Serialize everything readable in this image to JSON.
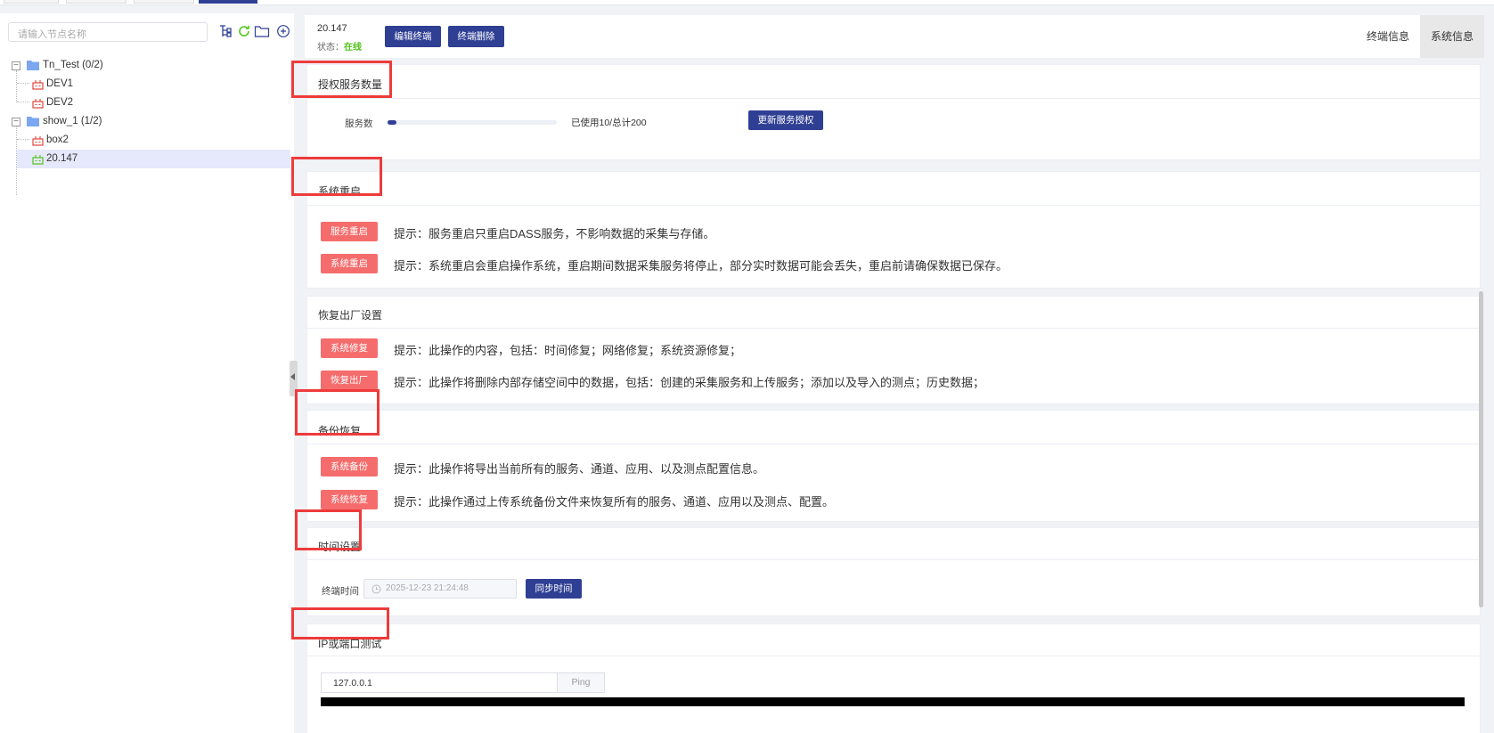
{
  "left": {
    "search_placeholder": "请输入节点名称",
    "tree": [
      {
        "label": "Tn_Test (0/2)",
        "type": "group",
        "expander": "−"
      },
      {
        "label": "DEV1",
        "type": "device",
        "status": "offline"
      },
      {
        "label": "DEV2",
        "type": "device",
        "status": "offline"
      },
      {
        "label": "show_1 (1/2)",
        "type": "group",
        "expander": "−"
      },
      {
        "label": "box2",
        "type": "device",
        "status": "offline"
      },
      {
        "label": "20.147",
        "type": "device",
        "status": "online",
        "selected": true
      }
    ]
  },
  "header": {
    "ip": "20.147",
    "status_label": "状态：",
    "status_value": "在线",
    "edit_button": "编辑终端",
    "delete_button": "终端删除",
    "tabs": [
      "终端信息",
      "系统信息"
    ],
    "active_tab": "系统信息"
  },
  "sections": {
    "license": {
      "title": "授权服务数量",
      "service_label": "服务数",
      "used": 10,
      "total": 200,
      "progress_text": "已使用10/总计200",
      "update_button": "更新服务授权"
    },
    "restart": {
      "title": "系统重启",
      "rows": [
        {
          "button": "服务重启",
          "tip": "提示：服务重启只重启DASS服务，不影响数据的采集与存储。"
        },
        {
          "button": "系统重启",
          "tip": "提示：系统重启会重启操作系统，重启期间数据采集服务将停止，部分实时数据可能会丢失，重启前请确保数据已保存。"
        }
      ]
    },
    "factory": {
      "title": "恢复出厂设置",
      "rows": [
        {
          "button": "系统修复",
          "tip": "提示：此操作的内容，包括：时间修复；网络修复；系统资源修复；"
        },
        {
          "button": "恢复出厂",
          "tip": "提示：此操作将删除内部存储空间中的数据，包括：创建的采集服务和上传服务；添加以及导入的测点；历史数据；"
        }
      ]
    },
    "backup": {
      "title": "备份恢复",
      "rows": [
        {
          "button": "系统备份",
          "tip": "提示：此操作将导出当前所有的服务、通道、应用、以及测点配置信息。"
        },
        {
          "button": "系统恢复",
          "tip": "提示：此操作通过上传系统备份文件来恢复所有的服务、通道、应用以及测点、配置。"
        }
      ]
    },
    "time": {
      "title": "时间设置",
      "label": "终端时间",
      "value": "2025-12-23 21:24:48",
      "sync_button": "同步时间"
    },
    "ping": {
      "title": "IP或端口测试",
      "input_value": "127.0.0.1",
      "button": "Ping"
    }
  },
  "colors": {
    "primary": "#2f3f94",
    "danger": "#f56c6c",
    "online": "#52c41a",
    "offline_device": "#e0473c",
    "online_device": "#52c41a",
    "highlight_box": "#ee3b3b",
    "folder": "#7aa7f0"
  }
}
